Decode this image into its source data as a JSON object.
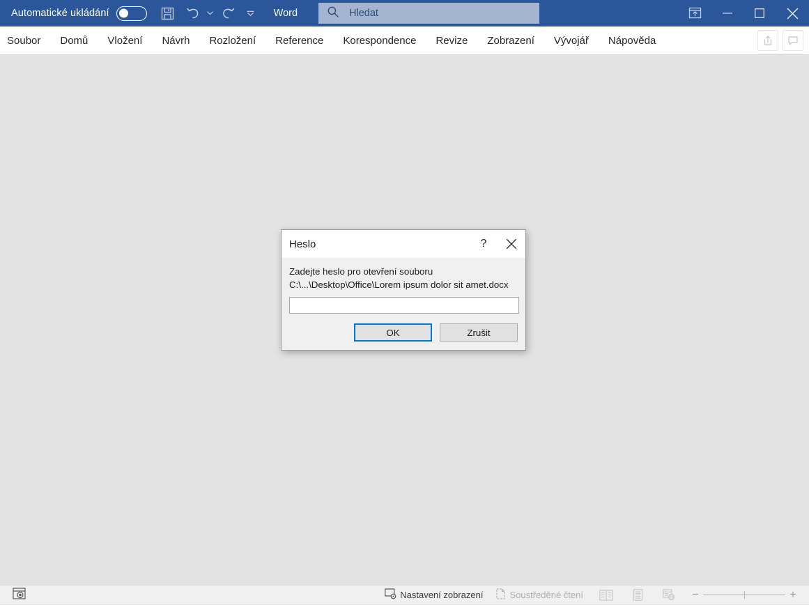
{
  "titlebar": {
    "autosave_label": "Automatické ukládání",
    "autosave_state": "off",
    "app_label": "Word",
    "icons": {
      "save": "save-icon",
      "undo": "undo-icon",
      "redo": "redo-icon",
      "customize_qat": "customize-quick-access-toolbar-icon"
    },
    "window_controls": {
      "ribbon_display": "ribbon-display-options-icon",
      "minimize": "minimize-icon",
      "maximize": "maximize-icon",
      "close": "close-icon"
    },
    "accent_color": "#2b579a"
  },
  "search": {
    "placeholder": "Hledat",
    "value": "",
    "icon": "search-icon",
    "background": "#a3b5d0"
  },
  "ribbon": {
    "tabs": [
      {
        "label": "Soubor"
      },
      {
        "label": "Domů"
      },
      {
        "label": "Vložení"
      },
      {
        "label": "Návrh"
      },
      {
        "label": "Rozložení"
      },
      {
        "label": "Reference"
      },
      {
        "label": "Korespondence"
      },
      {
        "label": "Revize"
      },
      {
        "label": "Zobrazení"
      },
      {
        "label": "Vývojář"
      },
      {
        "label": "Nápověda"
      }
    ],
    "share_icon": "share-icon",
    "comments_icon": "comment-icon"
  },
  "dialog": {
    "title": "Heslo",
    "help_glyph": "?",
    "close_glyph": "✕",
    "prompt_line1": "Zadejte heslo pro otevření souboru",
    "prompt_line2": "C:\\...\\Desktop\\Office\\Lorem ipsum dolor sit amet.docx",
    "password_value": "",
    "password_placeholder": "",
    "ok_label": "OK",
    "cancel_label": "Zrušit",
    "focus_color": "#0078d7"
  },
  "statusbar": {
    "macro_icon": "record-macro-icon",
    "display_settings_label": "Nastavení zobrazení",
    "display_settings_icon": "display-settings-icon",
    "focus_read_label": "Soustředěné čtení",
    "focus_read_icon": "focus-read-icon",
    "view_read_icon": "read-mode-icon",
    "view_print_icon": "print-layout-icon",
    "view_web_icon": "web-layout-icon",
    "zoom_minus": "−",
    "zoom_plus": "+"
  },
  "document": {
    "background": "#e3e3e3"
  }
}
